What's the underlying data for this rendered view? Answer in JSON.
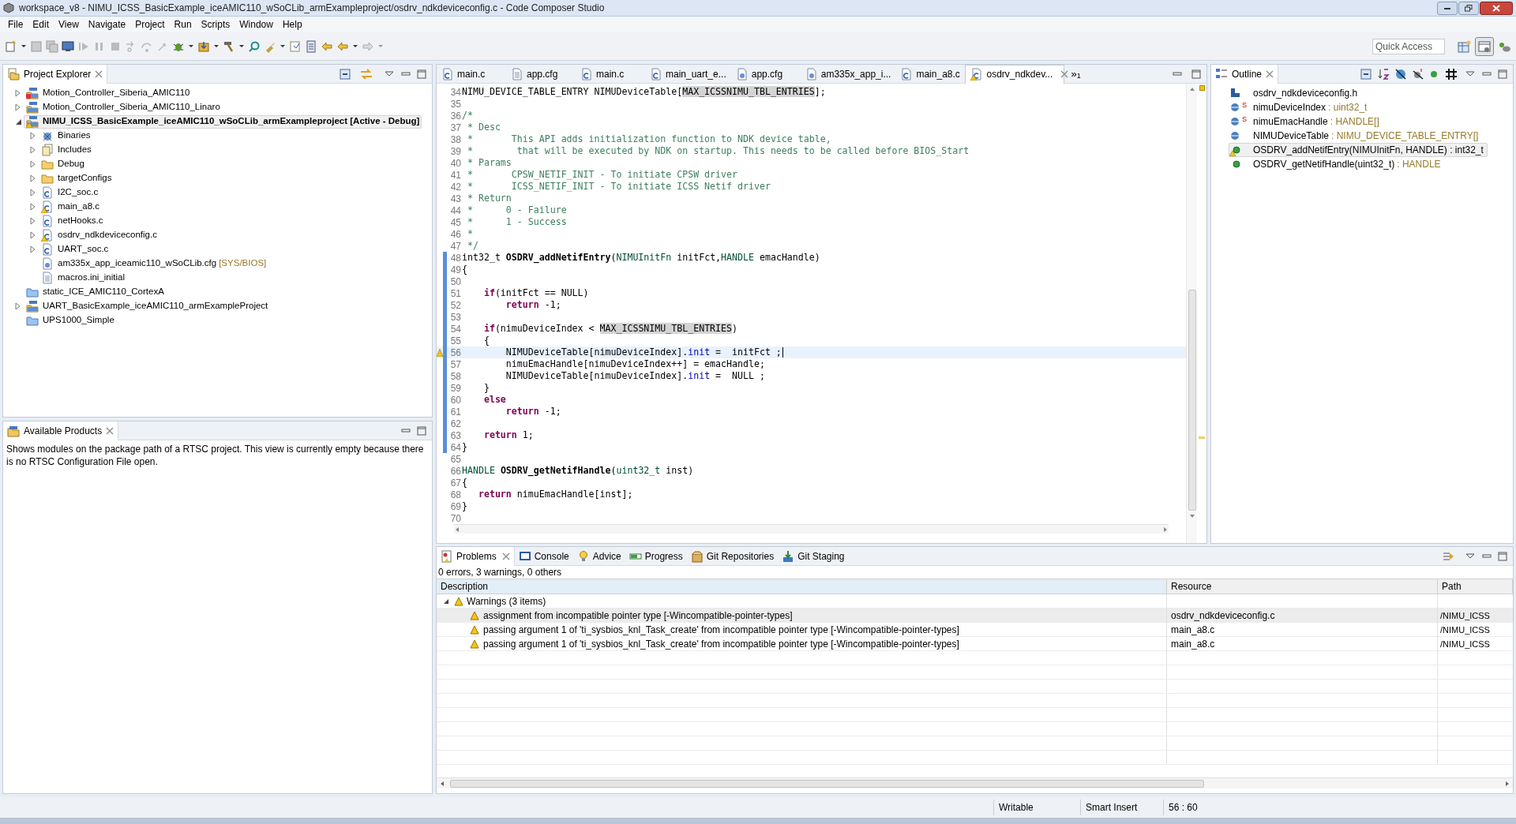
{
  "window": {
    "title": "workspace_v8 - NIMU_ICSS_BasicExample_iceAMIC110_wSoCLib_armExampleproject/osdrv_ndkdeviceconfig.c - Code Composer Studio"
  },
  "menu": [
    "File",
    "Edit",
    "View",
    "Navigate",
    "Project",
    "Run",
    "Scripts",
    "Window",
    "Help"
  ],
  "quick_access": {
    "placeholder": "Quick Access"
  },
  "project_explorer": {
    "title": "Project Explorer",
    "items": [
      {
        "label": "Motion_Controller_Siberia_AMIC110",
        "kind": "rtsc_project",
        "error": true,
        "warning": false,
        "expanded": false,
        "selected": false
      },
      {
        "label": "Motion_Controller_Siberia_AMIC110_Linaro",
        "kind": "rtsc_project",
        "error": false,
        "warning": false,
        "expanded": false,
        "selected": false
      },
      {
        "label": "NIMU_ICSS_BasicExample_iceAMIC110_wSoCLib_armExampleproject  [Active - Debug]",
        "kind": "rtsc_project",
        "error": false,
        "warning": true,
        "expanded": true,
        "selected": true,
        "children": [
          {
            "label": "Binaries",
            "kind": "binaries",
            "error": false,
            "warning": false,
            "expanded": false,
            "selected": false
          },
          {
            "label": "Includes",
            "kind": "includes",
            "error": false,
            "warning": false,
            "expanded": false,
            "selected": false
          },
          {
            "label": "Debug",
            "kind": "folder",
            "error": false,
            "warning": false,
            "expanded": false,
            "selected": false
          },
          {
            "label": "targetConfigs",
            "kind": "folder",
            "error": false,
            "warning": false,
            "expanded": false,
            "selected": false
          },
          {
            "label": "I2C_soc.c",
            "kind": "c_file",
            "error": false,
            "warning": false,
            "expanded": false,
            "selected": false
          },
          {
            "label": "main_a8.c",
            "kind": "c_file",
            "error": false,
            "warning": true,
            "expanded": false,
            "selected": false
          },
          {
            "label": "netHooks.c",
            "kind": "c_file",
            "error": false,
            "warning": false,
            "expanded": false,
            "selected": false
          },
          {
            "label": "osdrv_ndkdeviceconfig.c",
            "kind": "c_file",
            "error": false,
            "warning": true,
            "expanded": false,
            "selected": false
          },
          {
            "label": "UART_soc.c",
            "kind": "c_file",
            "error": false,
            "warning": false,
            "expanded": false,
            "selected": false
          },
          {
            "label": "am335x_app_iceamic110_wSoCLib.cfg",
            "decoration": "[SYS/BIOS]",
            "kind": "cfg_file",
            "error": false,
            "warning": false,
            "selected": false
          },
          {
            "label": "macros.ini_initial",
            "kind": "text_file",
            "error": false,
            "warning": false,
            "selected": false
          }
        ]
      },
      {
        "label": "static_ICE_AMIC110_CortexA",
        "kind": "closed_project",
        "error": false,
        "warning": false,
        "selected": false
      },
      {
        "label": "UART_BasicExample_iceAMIC110_armExampleProject",
        "kind": "rtsc_project",
        "error": false,
        "warning": false,
        "expanded": false,
        "selected": false
      },
      {
        "label": "UPS1000_Simple",
        "kind": "closed_project",
        "error": false,
        "warning": false,
        "selected": false
      }
    ]
  },
  "available_products": {
    "title": "Available Products",
    "message": "Shows modules on the package path of a RTSC project. This view is currently empty because there is no RTSC Configuration File open."
  },
  "editor": {
    "tabs": [
      {
        "label": "main.c",
        "kind": "c",
        "selected": false,
        "warning": false
      },
      {
        "label": "app.cfg",
        "kind": "text",
        "selected": false,
        "warning": false
      },
      {
        "label": "main.c",
        "kind": "c",
        "selected": false,
        "warning": false
      },
      {
        "label": "main_uart_e...",
        "kind": "c",
        "selected": false,
        "warning": false
      },
      {
        "label": "app.cfg",
        "kind": "cfg",
        "selected": false,
        "warning": false
      },
      {
        "label": "am335x_app_i...",
        "kind": "cfg",
        "selected": false,
        "warning": false
      },
      {
        "label": "main_a8.c",
        "kind": "c",
        "selected": false,
        "warning": false
      },
      {
        "label": "osdrv_ndkdev...",
        "kind": "c",
        "selected": true,
        "warning": true
      }
    ],
    "overflow": {
      "glyph": "»",
      "count": "1"
    },
    "lines": [
      {
        "number": "34",
        "changed": false,
        "current": false,
        "warning": false,
        "segments": [
          {
            "kind": "plain",
            "text": "NIMU_DEVICE_TABLE_ENTRY NIMUDeviceTable["
          },
          {
            "kind": "occurrence",
            "text": "MAX_ICSSNIMU_TBL_ENTRIES"
          },
          {
            "kind": "plain",
            "text": "];"
          }
        ]
      },
      {
        "number": "35",
        "changed": false,
        "current": false,
        "warning": false
      },
      {
        "number": "36",
        "changed": false,
        "current": false,
        "warning": false,
        "segments": [
          {
            "kind": "comment",
            "text": "/*"
          }
        ]
      },
      {
        "number": "37",
        "changed": false,
        "current": false,
        "warning": false,
        "segments": [
          {
            "kind": "comment",
            "text": " * Desc"
          }
        ]
      },
      {
        "number": "38",
        "changed": false,
        "current": false,
        "warning": false,
        "segments": [
          {
            "kind": "comment",
            "text": " *       This API adds initialization function to NDK device table,"
          }
        ]
      },
      {
        "number": "39",
        "changed": false,
        "current": false,
        "warning": false,
        "segments": [
          {
            "kind": "comment",
            "text": " *        that will be executed by NDK on startup. This needs to be called before BIOS_Start"
          }
        ]
      },
      {
        "number": "40",
        "changed": false,
        "current": false,
        "warning": false,
        "segments": [
          {
            "kind": "comment",
            "text": " * Params"
          }
        ]
      },
      {
        "number": "41",
        "changed": false,
        "current": false,
        "warning": false,
        "segments": [
          {
            "kind": "comment",
            "text": " *       CPSW_NETIF_INIT - To initiate CPSW driver"
          }
        ]
      },
      {
        "number": "42",
        "changed": false,
        "current": false,
        "warning": false,
        "segments": [
          {
            "kind": "comment",
            "text": " *       ICSS_NETIF_INIT - To initiate ICSS Netif driver"
          }
        ]
      },
      {
        "number": "43",
        "changed": false,
        "current": false,
        "warning": false,
        "segments": [
          {
            "kind": "comment",
            "text": " * Return"
          }
        ]
      },
      {
        "number": "44",
        "changed": false,
        "current": false,
        "warning": false,
        "segments": [
          {
            "kind": "comment",
            "text": " *      0 - Failure"
          }
        ]
      },
      {
        "number": "45",
        "changed": false,
        "current": false,
        "warning": false,
        "segments": [
          {
            "kind": "comment",
            "text": " *      1 - Success"
          }
        ]
      },
      {
        "number": "46",
        "changed": false,
        "current": false,
        "warning": false,
        "segments": [
          {
            "kind": "comment",
            "text": " *"
          }
        ]
      },
      {
        "number": "47",
        "changed": false,
        "current": false,
        "warning": false,
        "segments": [
          {
            "kind": "comment",
            "text": " */"
          }
        ]
      },
      {
        "number": "48",
        "changed": true,
        "current": false,
        "warning": false,
        "segments": [
          {
            "kind": "plain",
            "text": "int32_t "
          },
          {
            "kind": "function",
            "text": "OSDRV_addNetifEntry"
          },
          {
            "kind": "plain",
            "text": "("
          },
          {
            "kind": "type",
            "text": "NIMUInitFn"
          },
          {
            "kind": "plain",
            "text": " initFct,"
          },
          {
            "kind": "type",
            "text": "HANDLE"
          },
          {
            "kind": "plain",
            "text": " emacHandle)"
          }
        ]
      },
      {
        "number": "49",
        "changed": true,
        "current": false,
        "warning": false,
        "segments": [
          {
            "kind": "plain",
            "text": "{"
          }
        ]
      },
      {
        "number": "50",
        "changed": true,
        "current": false,
        "warning": false
      },
      {
        "number": "51",
        "changed": true,
        "current": false,
        "warning": false,
        "segments": [
          {
            "kind": "keyword",
            "text": "    if"
          },
          {
            "kind": "plain",
            "text": "(initFct == NULL)"
          }
        ]
      },
      {
        "number": "52",
        "changed": true,
        "current": false,
        "warning": false,
        "segments": [
          {
            "kind": "keyword",
            "text": "        return"
          },
          {
            "kind": "plain",
            "text": " -1;"
          }
        ]
      },
      {
        "number": "53",
        "changed": true,
        "current": false,
        "warning": false
      },
      {
        "number": "54",
        "changed": true,
        "current": false,
        "warning": false,
        "segments": [
          {
            "kind": "keyword",
            "text": "    if"
          },
          {
            "kind": "plain",
            "text": "(nimuDeviceIndex < "
          },
          {
            "kind": "occurrence",
            "text": "MAX_ICSSNIMU_TBL_ENTRIES"
          },
          {
            "kind": "plain",
            "text": ")"
          }
        ]
      },
      {
        "number": "55",
        "changed": true,
        "current": false,
        "warning": false,
        "segments": [
          {
            "kind": "plain",
            "text": "    {"
          }
        ]
      },
      {
        "number": "56",
        "changed": true,
        "current": true,
        "warning": true,
        "segments": [
          {
            "kind": "plain",
            "text": "        NIMUDeviceTable[nimuDeviceIndex]."
          },
          {
            "kind": "field",
            "text": "init"
          },
          {
            "kind": "plain",
            "text": " =  initFct ;"
          }
        ]
      },
      {
        "number": "57",
        "changed": true,
        "current": false,
        "warning": false,
        "segments": [
          {
            "kind": "plain",
            "text": "        nimuEmacHandle[nimuDeviceIndex++] = emacHandle;"
          }
        ]
      },
      {
        "number": "58",
        "changed": true,
        "current": false,
        "warning": false,
        "segments": [
          {
            "kind": "plain",
            "text": "        NIMUDeviceTable[nimuDeviceIndex]."
          },
          {
            "kind": "field",
            "text": "init"
          },
          {
            "kind": "plain",
            "text": " =  NULL ;"
          }
        ]
      },
      {
        "number": "59",
        "changed": true,
        "current": false,
        "warning": false,
        "segments": [
          {
            "kind": "plain",
            "text": "    }"
          }
        ]
      },
      {
        "number": "60",
        "changed": true,
        "current": false,
        "warning": false,
        "segments": [
          {
            "kind": "keyword",
            "text": "    else"
          }
        ]
      },
      {
        "number": "61",
        "changed": true,
        "current": false,
        "warning": false,
        "segments": [
          {
            "kind": "keyword",
            "text": "        return"
          },
          {
            "kind": "plain",
            "text": " -1;"
          }
        ]
      },
      {
        "number": "62",
        "changed": true,
        "current": false,
        "warning": false
      },
      {
        "number": "63",
        "changed": true,
        "current": false,
        "warning": false,
        "segments": [
          {
            "kind": "keyword",
            "text": "    return"
          },
          {
            "kind": "plain",
            "text": " 1;"
          }
        ]
      },
      {
        "number": "64",
        "changed": true,
        "current": false,
        "warning": false,
        "segments": [
          {
            "kind": "plain",
            "text": "}"
          }
        ]
      },
      {
        "number": "65",
        "changed": false,
        "current": false,
        "warning": false
      },
      {
        "number": "66",
        "changed": false,
        "current": false,
        "warning": false,
        "segments": [
          {
            "kind": "type",
            "text": "HANDLE "
          },
          {
            "kind": "function",
            "text": "OSDRV_getNetifHandle"
          },
          {
            "kind": "plain",
            "text": "("
          },
          {
            "kind": "type",
            "text": "uint32_t"
          },
          {
            "kind": "plain",
            "text": " inst)"
          }
        ]
      },
      {
        "number": "67",
        "changed": false,
        "current": false,
        "warning": false,
        "segments": [
          {
            "kind": "plain",
            "text": "{"
          }
        ]
      },
      {
        "number": "68",
        "changed": false,
        "current": false,
        "warning": false,
        "segments": [
          {
            "kind": "keyword",
            "text": "   return"
          },
          {
            "kind": "plain",
            "text": " nimuEmacHandle[inst];"
          }
        ]
      },
      {
        "number": "69",
        "changed": false,
        "current": false,
        "warning": false,
        "segments": [
          {
            "kind": "plain",
            "text": "}"
          }
        ]
      },
      {
        "number": "70",
        "changed": false,
        "current": false,
        "warning": false
      }
    ]
  },
  "outline": {
    "title": "Outline",
    "items": [
      {
        "label": "osdrv_ndkdeviceconfig.h",
        "kind": "include",
        "warning": false,
        "selected": false
      },
      {
        "label": "nimuDeviceIndex",
        "type": ": uint32_t",
        "kind": "variable",
        "badge": "S",
        "warning": false,
        "selected": false
      },
      {
        "label": "nimuEmacHandle",
        "type": ": HANDLE[]",
        "kind": "variable",
        "badge": "S",
        "warning": false,
        "selected": false
      },
      {
        "label": "NIMUDeviceTable",
        "type": ": NIMU_DEVICE_TABLE_ENTRY[]",
        "kind": "variable",
        "warning": false,
        "selected": false
      },
      {
        "label": "OSDRV_addNetifEntry(NIMUInitFn, HANDLE) : int32_t",
        "kind": "function",
        "warning": true,
        "selected": true
      },
      {
        "label": "OSDRV_getNetifHandle(uint32_t)",
        "type": ": HANDLE",
        "kind": "function",
        "warning": false,
        "selected": false
      }
    ]
  },
  "bottom_panel": {
    "tabs": [
      {
        "label": "Problems",
        "kind": "problems",
        "selected": true
      },
      {
        "label": "Console",
        "kind": "console",
        "selected": false
      },
      {
        "label": "Advice",
        "kind": "advice",
        "selected": false
      },
      {
        "label": "Progress",
        "kind": "progress",
        "selected": false
      },
      {
        "label": "Git Repositories",
        "kind": "git_repositories",
        "selected": false
      },
      {
        "label": "Git Staging",
        "kind": "git_staging",
        "selected": false
      }
    ],
    "summary": "0 errors, 3 warnings, 0 others",
    "columns": [
      "Description",
      "Resource",
      "Path"
    ],
    "group": {
      "label": "Warnings (3 items)",
      "expanded": true
    },
    "rows": [
      {
        "description": "assignment from incompatible pointer type [-Wincompatible-pointer-types]",
        "resource": "osdrv_ndkdeviceconfig.c",
        "path": "/NIMU_ICSS",
        "selected": true
      },
      {
        "description": "passing argument 1 of 'ti_sysbios_knl_Task_create' from incompatible pointer type [-Wincompatible-pointer-types]",
        "resource": "main_a8.c",
        "path": "/NIMU_ICSS",
        "selected": false
      },
      {
        "description": "passing argument 1 of 'ti_sysbios_knl_Task_create' from incompatible pointer type [-Wincompatible-pointer-types]",
        "resource": "main_a8.c",
        "path": "/NIMU_ICSS",
        "selected": false
      }
    ]
  },
  "status_bar": [
    "Writable",
    "Smart Insert",
    "56 : 60"
  ]
}
